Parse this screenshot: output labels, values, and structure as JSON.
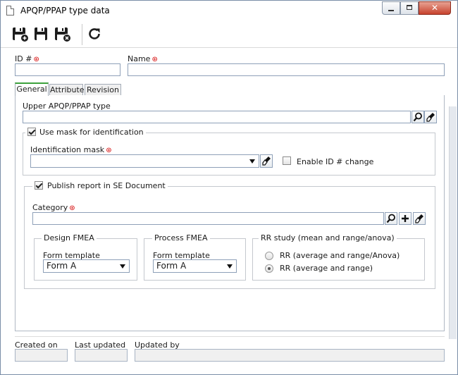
{
  "window": {
    "title": "APQP/PPAP type data",
    "controls": {
      "minimize": "minimize",
      "maximize": "maximize",
      "close": "✕"
    }
  },
  "toolbar": {
    "buttons": [
      {
        "name": "save-and-new",
        "icon": "save-new-icon"
      },
      {
        "name": "save",
        "icon": "save-icon"
      },
      {
        "name": "save-and-close",
        "icon": "save-close-icon"
      },
      {
        "name": "refresh",
        "icon": "refresh-icon"
      }
    ]
  },
  "header": {
    "id_label": "ID #",
    "id_value": "",
    "name_label": "Name",
    "name_value": ""
  },
  "tabs": [
    {
      "label": "General",
      "active": true
    },
    {
      "label": "Attribute",
      "active": false
    },
    {
      "label": "Revision",
      "active": false
    }
  ],
  "general": {
    "upper_type_label": "Upper APQP/PPAP type",
    "upper_type_value": "",
    "use_mask": {
      "label": "Use mask for identification",
      "checked": true
    },
    "identification_mask_label": "Identification mask",
    "identification_mask_value": "",
    "enable_id_change": {
      "label": "Enable ID # change",
      "checked": false
    },
    "publish": {
      "label": "Publish report in SE Document",
      "checked": true
    },
    "category_label": "Category",
    "category_value": "",
    "design_fmea": {
      "title": "Design FMEA",
      "form_label": "Form template",
      "form_value": "Form A"
    },
    "process_fmea": {
      "title": "Process FMEA",
      "form_label": "Form template",
      "form_value": "Form A"
    },
    "rr_study": {
      "title": "RR study (mean and range/anova)",
      "options": [
        {
          "label": "RR (average and range/Anova)",
          "selected": false
        },
        {
          "label": "RR (average and range)",
          "selected": true
        }
      ]
    }
  },
  "footer": {
    "created_on_label": "Created on",
    "created_on_value": "",
    "last_updated_label": "Last updated",
    "last_updated_value": "",
    "updated_by_label": "Updated by",
    "updated_by_value": ""
  },
  "colors": {
    "tab_accent": "#3da23d",
    "required": "#d40000",
    "input_border": "#8ea0b8"
  }
}
